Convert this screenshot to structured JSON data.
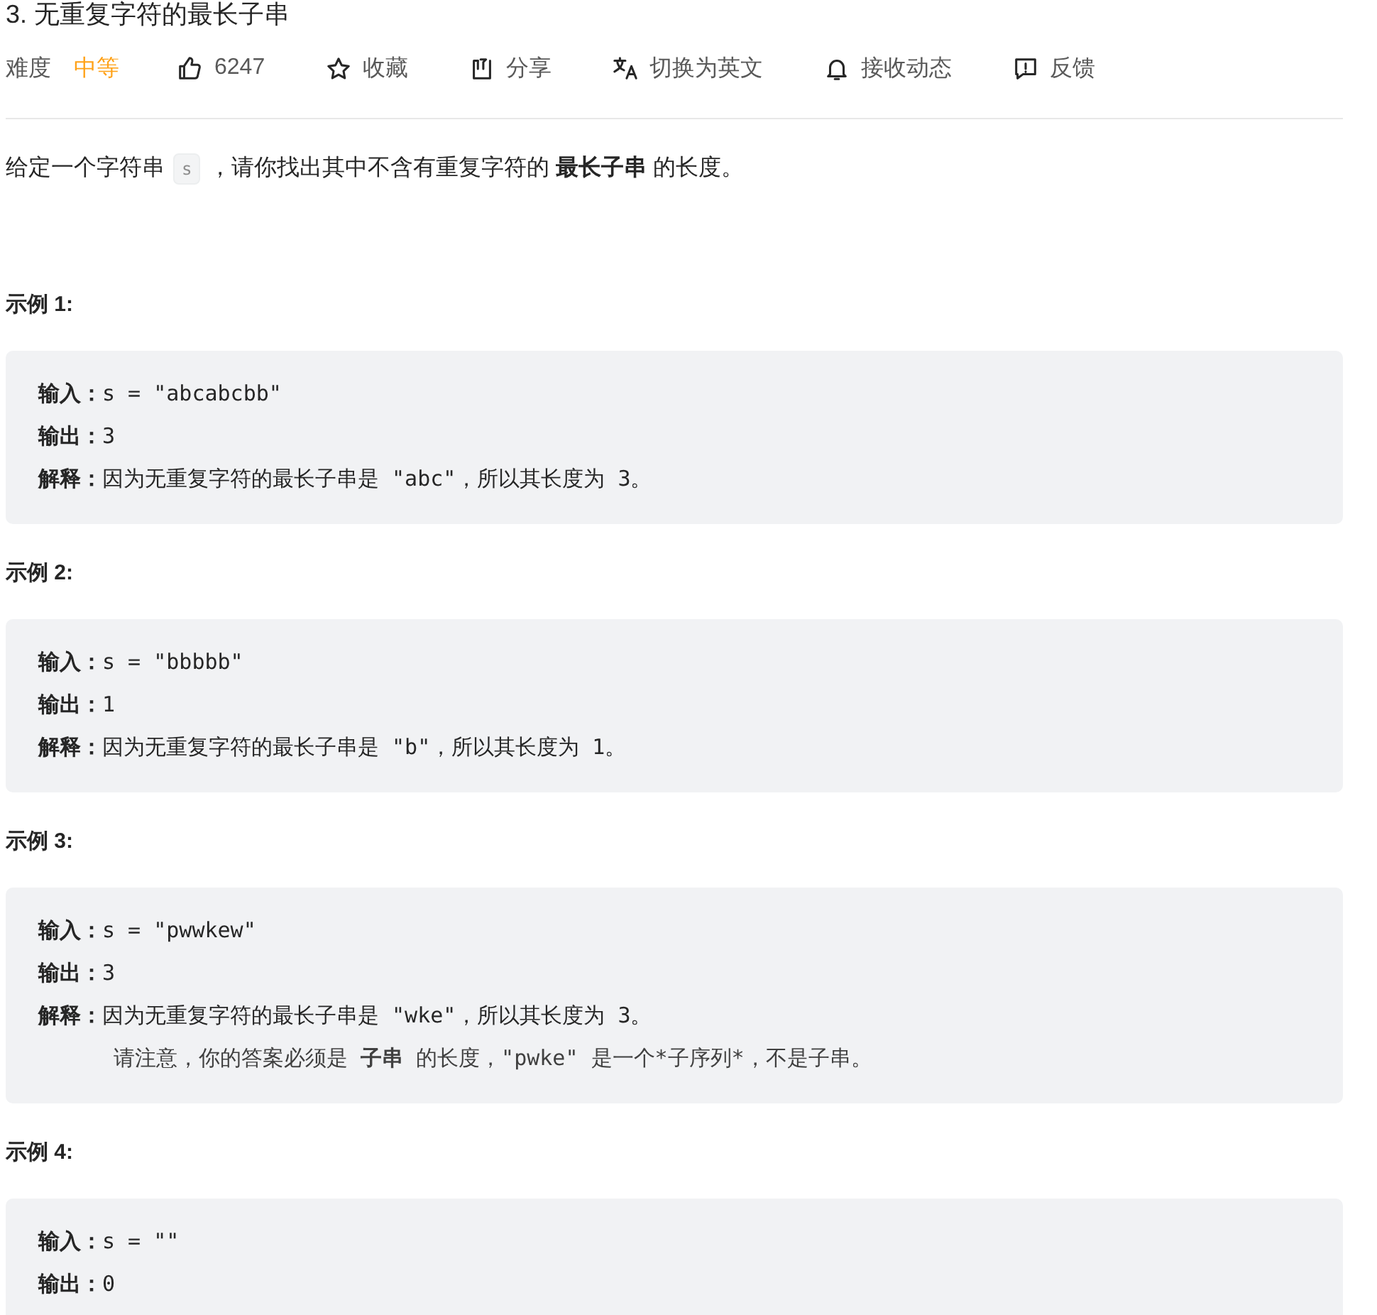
{
  "title": "3. 无重复字符的最长子串",
  "toolbar": [
    {
      "kind": "difficulty",
      "label": "难度",
      "value": "中等"
    },
    {
      "kind": "like",
      "label": "6247"
    },
    {
      "kind": "star",
      "label": "收藏"
    },
    {
      "kind": "share",
      "label": "分享"
    },
    {
      "kind": "translate",
      "label": "切换为英文"
    },
    {
      "kind": "bell",
      "label": "接收动态"
    },
    {
      "kind": "feedback",
      "label": "反馈"
    }
  ],
  "description": [
    {
      "kind": "text",
      "text": "给定一个字符串"
    },
    {
      "kind": "code",
      "text": "s"
    },
    {
      "kind": "text",
      "text": "，请你找出其中不含有重复字符的 **最长子串** 的长度。"
    }
  ],
  "examples": [
    {
      "heading": "示例 1:",
      "lines": [
        {
          "kind": "field",
          "label": "输入：",
          "text": "s = \"abcabcbb\""
        },
        {
          "kind": "field",
          "label": "输出：",
          "text": "3"
        },
        {
          "kind": "field",
          "label": "解释：",
          "text": "因为无重复字符的最长子串是 \"abc\"，所以其长度为 3。"
        }
      ]
    },
    {
      "heading": "示例 2:",
      "lines": [
        {
          "kind": "field",
          "label": "输入：",
          "text": "s = \"bbbbb\""
        },
        {
          "kind": "field",
          "label": "输出：",
          "text": "1"
        },
        {
          "kind": "field",
          "label": "解释：",
          "text": "因为无重复字符的最长子串是 \"b\"，所以其长度为 1。"
        }
      ]
    },
    {
      "heading": "示例 3:",
      "lines": [
        {
          "kind": "field",
          "label": "输入：",
          "text": "s = \"pwwkew\""
        },
        {
          "kind": "field",
          "label": "输出：",
          "text": "3"
        },
        {
          "kind": "field",
          "label": "解释：",
          "text": "因为无重复字符的最长子串是 \"wke\"，所以其长度为 3。"
        },
        {
          "kind": "note",
          "text": "请注意，你的答案必须是 **子串** 的长度，\"pwke\" 是一个*子序列*，不是子串。"
        }
      ]
    },
    {
      "heading": "示例 4:",
      "lines": [
        {
          "kind": "field",
          "label": "输入：",
          "text": "s = \"\""
        },
        {
          "kind": "field",
          "label": "输出：",
          "text": "0"
        }
      ]
    }
  ]
}
